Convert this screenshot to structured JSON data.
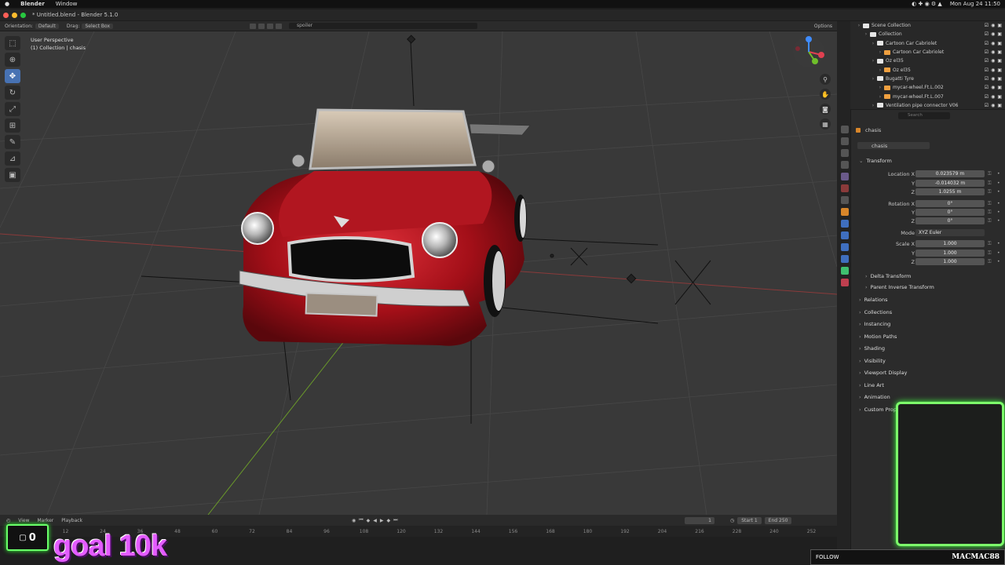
{
  "menubar": {
    "app": "Blender",
    "window": "Window",
    "datetime": "Mon Aug 24  11:50"
  },
  "titlebar": {
    "title": "* Untitled.blend - Blender 5.1.0"
  },
  "viewport_header": {
    "orientation_label": "Orientation:",
    "orientation_value": "Default",
    "drag_label": "Drag:",
    "drag_value": "Select Box",
    "search_value": "spoiler",
    "options_label": "Options"
  },
  "viewport": {
    "perspective": "User Perspective",
    "context": "(1) Collection | chasis"
  },
  "outliner": {
    "rows": [
      {
        "label": "Scene Collection",
        "indent": 0,
        "color": "#e6e6e6"
      },
      {
        "label": "Collection",
        "indent": 1,
        "color": "#e6e6e6"
      },
      {
        "label": "Cartoon Car Cabriolet",
        "indent": 2,
        "color": "#e6e6e6"
      },
      {
        "label": "Cartoon Car Cabriolet",
        "indent": 3,
        "color": "#f0a040"
      },
      {
        "label": "Oz el35",
        "indent": 2,
        "color": "#e6e6e6"
      },
      {
        "label": "Oz el35",
        "indent": 3,
        "color": "#f0a040"
      },
      {
        "label": "Bugatti Tyre",
        "indent": 2,
        "color": "#e6e6e6"
      },
      {
        "label": "mycar-wheel.Ft.L.002",
        "indent": 3,
        "color": "#f0a040"
      },
      {
        "label": "mycar-wheel.Ft.L.007",
        "indent": 3,
        "color": "#f0a040"
      },
      {
        "label": "Ventilation pipe connector V06",
        "indent": 2,
        "color": "#e6e6e6"
      }
    ]
  },
  "properties": {
    "search_placeholder": "Search",
    "object_name": "chasis",
    "object_data_name": "chasis",
    "transform_title": "Transform",
    "location": {
      "label_x": "Location X",
      "x": "0.023579 m",
      "y": "-0.014032 m",
      "z": "1.0255 m"
    },
    "rotation": {
      "label_x": "Rotation X",
      "x": "0°",
      "y": "0°",
      "z": "0°"
    },
    "mode_label": "Mode",
    "mode_value": "XYZ Euler",
    "scale": {
      "label_x": "Scale X",
      "x": "1.000",
      "y": "1.000",
      "z": "1.000"
    },
    "axis": {
      "y": "Y",
      "z": "Z"
    },
    "subsections": [
      "Delta Transform",
      "Parent Inverse Transform"
    ],
    "sections": [
      "Relations",
      "Collections",
      "Instancing",
      "Motion Paths",
      "Shading",
      "Visibility",
      "Viewport Display",
      "Line Art",
      "Animation",
      "Custom Properties"
    ]
  },
  "timeline": {
    "view": "View",
    "marker": "Marker",
    "playback": "Playback",
    "current_frame": "1",
    "start_label": "Start",
    "start": "1",
    "end_label": "End",
    "end": "250",
    "ticks": [
      "0",
      "12",
      "24",
      "36",
      "48",
      "60",
      "72",
      "84",
      "96",
      "108",
      "120",
      "132",
      "144",
      "156",
      "168",
      "180",
      "192",
      "204",
      "216",
      "228",
      "240",
      "252"
    ]
  },
  "overlay": {
    "counter": "0",
    "goal": "goal 10k",
    "follow": "FOLLOW",
    "streamer": "MACMAC88"
  },
  "colors": {
    "accent": "#4772b3",
    "car_red": "#c0141c",
    "overlay_green": "#7dff6b",
    "overlay_magenta": "#e45cff"
  }
}
